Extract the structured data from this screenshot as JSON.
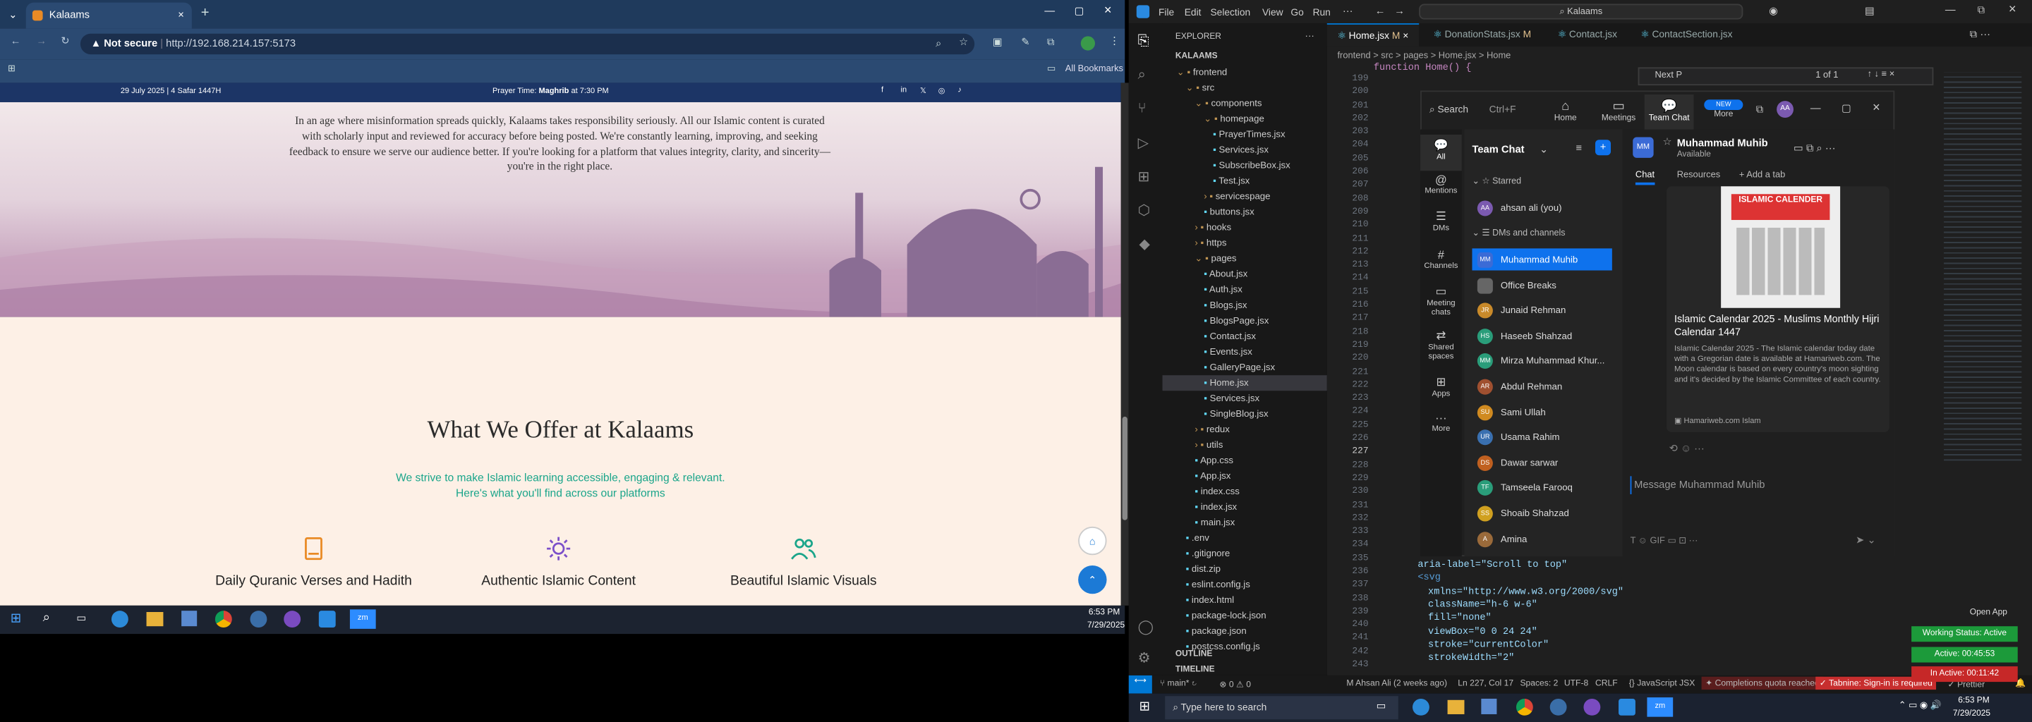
{
  "browser": {
    "tab_title": "Kalaams",
    "not_secure": "Not secure",
    "url": "http://192.168.214.157:5173",
    "bookmarks": "All Bookmarks"
  },
  "site": {
    "date": "29 July 2025 | 4 Safar 1447H",
    "prayer_label": "Prayer Time:",
    "prayer_name": "Maghrib",
    "prayer_time": "at 7:30 PM",
    "hero_text": "In an age where misinformation spreads quickly, Kalaams takes responsibility seriously. All our Islamic content is curated with scholarly input and reviewed for accuracy before being posted. We're constantly learning, improving, and seeking feedback to ensure we serve our audience better. If you're looking for a platform that values integrity, clarity, and sincerity—you're in the right place.",
    "section_title": "What We Offer at Kalaams",
    "section_sub1": "We strive to make Islamic learning accessible, engaging & relevant.",
    "section_sub2": "Here's what you'll find across our platforms",
    "features": [
      "Daily Quranic Verses and Hadith",
      "Authentic Islamic Content",
      "Beautiful Islamic Visuals"
    ]
  },
  "taskbar_left": {
    "time": "6:53 PM",
    "date": "7/29/2025"
  },
  "vscode": {
    "menu": [
      "File",
      "Edit",
      "Selection",
      "View",
      "Go",
      "Run"
    ],
    "search": "Kalaams",
    "explorer": "EXPLORER",
    "root": "KALAAMS",
    "tabs": [
      {
        "label": "Home.jsx",
        "mod": "M"
      },
      {
        "label": "DonationStats.jsx",
        "mod": "M"
      },
      {
        "label": "Contact.jsx",
        "mod": ""
      },
      {
        "label": "ContactSection.jsx",
        "mod": ""
      }
    ],
    "breadcrumb": "frontend > src > pages > Home.jsx > Home",
    "tree": [
      {
        "label": "frontend",
        "indent": 1,
        "type": "folder-open"
      },
      {
        "label": "src",
        "indent": 2,
        "type": "folder-open"
      },
      {
        "label": "components",
        "indent": 3,
        "type": "folder-open"
      },
      {
        "label": "homepage",
        "indent": 4,
        "type": "folder-open"
      },
      {
        "label": "PrayerTimes.jsx",
        "indent": 5,
        "type": "file"
      },
      {
        "label": "Services.jsx",
        "indent": 5,
        "type": "file"
      },
      {
        "label": "SubscribeBox.jsx",
        "indent": 5,
        "type": "file"
      },
      {
        "label": "Test.jsx",
        "indent": 5,
        "type": "file"
      },
      {
        "label": "servicespage",
        "indent": 4,
        "type": "folder"
      },
      {
        "label": "buttons.jsx",
        "indent": 4,
        "type": "file"
      },
      {
        "label": "hooks",
        "indent": 3,
        "type": "folder"
      },
      {
        "label": "https",
        "indent": 3,
        "type": "folder"
      },
      {
        "label": "pages",
        "indent": 3,
        "type": "folder-open"
      },
      {
        "label": "About.jsx",
        "indent": 4,
        "type": "file"
      },
      {
        "label": "Auth.jsx",
        "indent": 4,
        "type": "file"
      },
      {
        "label": "Blogs.jsx",
        "indent": 4,
        "type": "file"
      },
      {
        "label": "BlogsPage.jsx",
        "indent": 4,
        "type": "file"
      },
      {
        "label": "Contact.jsx",
        "indent": 4,
        "type": "file"
      },
      {
        "label": "Events.jsx",
        "indent": 4,
        "type": "file"
      },
      {
        "label": "GalleryPage.jsx",
        "indent": 4,
        "type": "file"
      },
      {
        "label": "Home.jsx",
        "indent": 4,
        "type": "file-active"
      },
      {
        "label": "Services.jsx",
        "indent": 4,
        "type": "file"
      },
      {
        "label": "SingleBlog.jsx",
        "indent": 4,
        "type": "file"
      },
      {
        "label": "redux",
        "indent": 3,
        "type": "folder"
      },
      {
        "label": "utils",
        "indent": 3,
        "type": "folder"
      },
      {
        "label": "App.css",
        "indent": 3,
        "type": "file"
      },
      {
        "label": "App.jsx",
        "indent": 3,
        "type": "file"
      },
      {
        "label": "index.css",
        "indent": 3,
        "type": "file"
      },
      {
        "label": "index.jsx",
        "indent": 3,
        "type": "file"
      },
      {
        "label": "main.jsx",
        "indent": 3,
        "type": "file"
      },
      {
        "label": ".env",
        "indent": 2,
        "type": "file"
      },
      {
        "label": ".gitignore",
        "indent": 2,
        "type": "file"
      },
      {
        "label": "dist.zip",
        "indent": 2,
        "type": "file"
      },
      {
        "label": "eslint.config.js",
        "indent": 2,
        "type": "file"
      },
      {
        "label": "index.html",
        "indent": 2,
        "type": "file"
      },
      {
        "label": "package-lock.json",
        "indent": 2,
        "type": "file"
      },
      {
        "label": "package.json",
        "indent": 2,
        "type": "file"
      },
      {
        "label": "postcss.config.js",
        "indent": 2,
        "type": "file"
      }
    ],
    "outline": "OUTLINE",
    "timeline": "TIMELINE",
    "line_numbers": [
      "199",
      "200",
      "201",
      "202",
      "203",
      "204",
      "205",
      "206",
      "207",
      "208",
      "209",
      "210",
      "211",
      "212",
      "213",
      "214",
      "215",
      "216",
      "217",
      "218",
      "219",
      "220",
      "221",
      "222",
      "223",
      "224",
      "225",
      "226",
      "227",
      "228",
      "229",
      "230",
      "231",
      "232",
      "233",
      "234",
      "235",
      "236",
      "237",
      "238",
      "239",
      "240",
      "241",
      "242",
      "243"
    ],
    "code_top": "function Home() {",
    "code_lines": [
      {
        "line": "aria-label=\"Scroll to top\"",
        "indent": 70
      },
      {
        "line": "<svg",
        "indent": 70
      },
      {
        "line": "xmlns=\"http://www.w3.org/2000/svg\"",
        "indent": 78
      },
      {
        "line": "className=\"h-6 w-6\"",
        "indent": 78
      },
      {
        "line": "fill=\"none\"",
        "indent": 78
      },
      {
        "line": "viewBox=\"0 0 24 24\"",
        "indent": 78
      },
      {
        "line": "stroke=\"currentColor\"",
        "indent": 78
      },
      {
        "line": "strokeWidth=\"2\"",
        "indent": 78
      }
    ],
    "find": {
      "value": "Next P",
      "result": "1 of 1"
    },
    "status": {
      "branch": "main*",
      "errors": "0",
      "warnings": "0",
      "user": "M Ahsan Ali (2 weeks ago)",
      "pos": "Ln 227, Col 17",
      "spaces": "Spaces: 2",
      "enc": "UTF-8",
      "eol": "CRLF",
      "lang": "JavaScript JSX",
      "quota": "Completions quota reached",
      "tabnine": "Tabnine: Sign-in is required",
      "prettier": "Prettier"
    }
  },
  "teams": {
    "search": "Search",
    "shortcut": "Ctrl+F",
    "nav_top": [
      "Home",
      "Meetings",
      "Team Chat",
      "More"
    ],
    "new_badge": "NEW",
    "nav_side": [
      "All",
      "Mentions",
      "DMs",
      "Channels",
      "Meeting chats",
      "Shared spaces",
      "Apps",
      "More"
    ],
    "list_title": "Team Chat",
    "starred": "Starred",
    "me": "ahsan ali (you)",
    "dms_channels": "DMs and channels",
    "contacts": [
      {
        "name": "Muhammad Muhib",
        "initials": "MM",
        "color": "#3b6bd6"
      },
      {
        "name": "Office Breaks",
        "initials": "",
        "color": "#666666"
      },
      {
        "name": "Junaid Rehman",
        "initials": "JR",
        "color": "#c98a2a"
      },
      {
        "name": "Haseeb Shahzad",
        "initials": "HS",
        "color": "#2a9d7a"
      },
      {
        "name": "Mirza Muhammad Khur...",
        "initials": "MM",
        "color": "#2a9d7a"
      },
      {
        "name": "Abdul Rehman",
        "initials": "AR",
        "color": "#a05030"
      },
      {
        "name": "Sami Ullah",
        "initials": "SU",
        "color": "#d08a20"
      },
      {
        "name": "Usama Rahim",
        "initials": "UR",
        "color": "#3a70b0"
      },
      {
        "name": "Dawar sarwar",
        "initials": "DS",
        "color": "#c06020"
      },
      {
        "name": "Tamseela Farooq",
        "initials": "TF",
        "color": "#2a9d7a"
      },
      {
        "name": "Shoaib Shahzad",
        "initials": "SS",
        "color": "#d0a020"
      },
      {
        "name": "Amina",
        "initials": "A",
        "color": "#9a6a3a"
      }
    ],
    "chat_name": "Muhammad Muhib",
    "chat_status": "Available",
    "chat_tabs": [
      "Chat",
      "Resources",
      "Add a tab"
    ],
    "card_title": "Islamic Calendar 2025 - Muslims Monthly Hijri Calendar 1447",
    "card_desc": "Islamic Calendar 2025 - The Islamic calendar today date with a Gregorian date is available at Hamariweb.com. The Moon calendar is based on every country's moon sighting and it's decided by the Islamic Committee of each country.",
    "card_source": "Hamariweb.com Islam",
    "cal_title": "ISLAMIC CALENDER",
    "compose": "Message Muhammad Muhib",
    "gif": "GIF"
  },
  "side_widgets": {
    "open_app": "Open App",
    "working": "Working Status: Active",
    "active": "Active: 00:45:53",
    "inactive": "In Active: 00:11:42"
  },
  "taskbar": {
    "search": "Type here to search",
    "time": "6:53 PM",
    "date": "7/29/2025"
  },
  "colors": {
    "accent": "#1aa58a",
    "teams_blue": "#0e72ed",
    "vs_blue": "#0078d4",
    "orange": "#e98a25"
  }
}
